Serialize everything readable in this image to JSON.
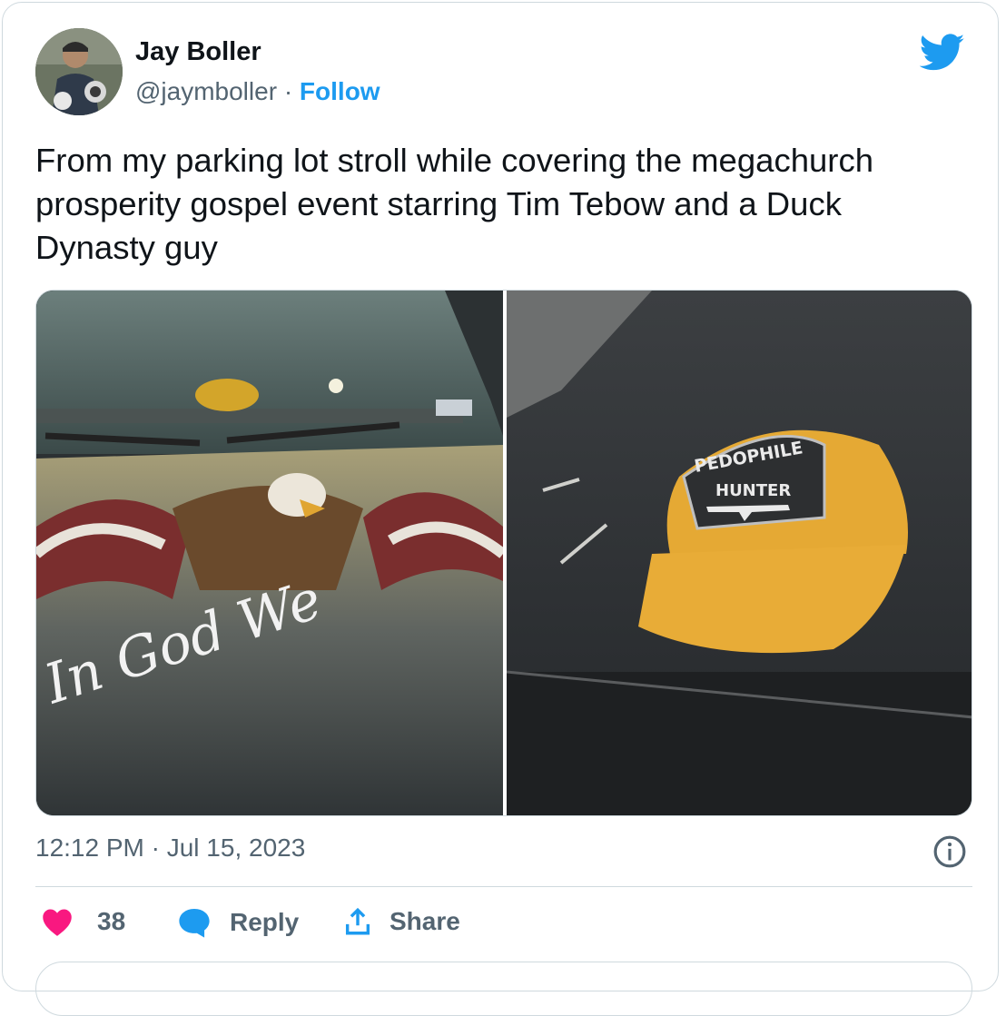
{
  "tweet": {
    "author": {
      "name": "Jay Boller",
      "handle": "@jaymboller",
      "separator": "·",
      "follow_label": "Follow"
    },
    "text": "From my parking lot stroll while covering the megachurch prosperity gospel event starring Tim Tebow and a Duck Dynasty guy",
    "media": {
      "left_photo": {
        "hood_script": "In God We",
        "description_icon": "eagle-flag-hood-decal"
      },
      "right_photo": {
        "cap_patch_line1": "PEDOPHILE",
        "cap_patch_line2": "HUNTER"
      }
    },
    "timestamp": "12:12 PM · Jul 15, 2023",
    "actions": {
      "like_count": "38",
      "reply_label": "Reply",
      "share_label": "Share"
    }
  },
  "colors": {
    "accent": "#1d9bf0",
    "like": "#f91880",
    "muted": "#536471",
    "border": "#cfd9de"
  },
  "icons": [
    "twitter-bird-icon",
    "info-icon",
    "heart-icon",
    "reply-bubble-icon",
    "share-icon"
  ]
}
